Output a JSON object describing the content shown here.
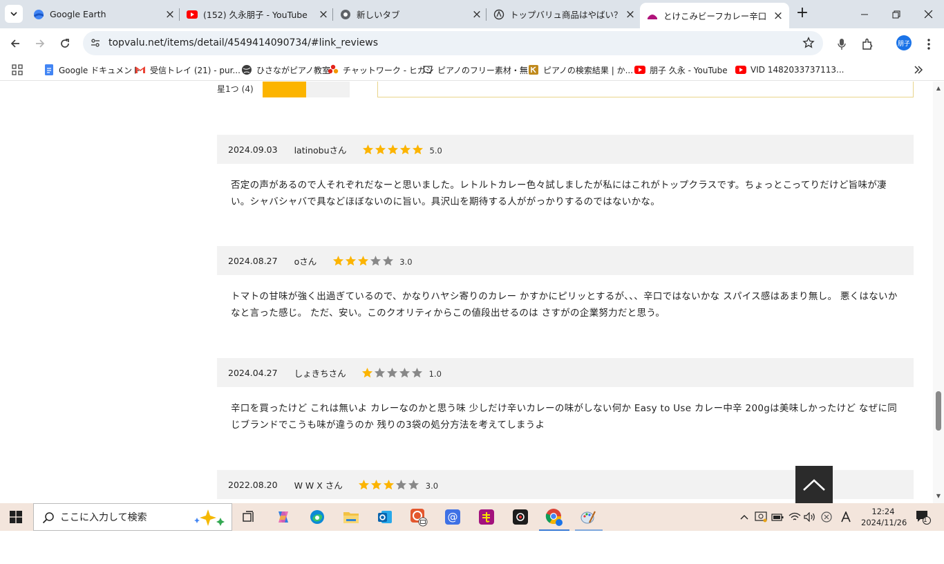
{
  "browser": {
    "tabs": [
      {
        "title": "Google Earth",
        "icon": "google-earth-icon",
        "active": false
      },
      {
        "title": "(152) 久永朋子 - YouTube",
        "icon": "youtube-icon",
        "active": false
      },
      {
        "title": "新しいタブ",
        "icon": "chrome-icon",
        "active": false
      },
      {
        "title": "トップバリュ商品はやばい？なぜ",
        "icon": "openai-icon",
        "active": false
      },
      {
        "title": "とけこみビーフカレー辛口 -イオン",
        "icon": "topvalu-icon",
        "active": true
      }
    ],
    "url": "topvalu.net/items/detail/4549414090734/#link_reviews",
    "profile_label": "朋子",
    "bookmarks": [
      {
        "label": "Google ドキュメント",
        "icon": "google-docs-icon"
      },
      {
        "label": "受信トレイ (21) - pur...",
        "icon": "gmail-icon"
      },
      {
        "label": "ひさながピアノ教室",
        "icon": "globe-icon"
      },
      {
        "label": "チャットワーク - ヒガシ",
        "icon": "chatwork-icon"
      },
      {
        "label": "ピアノのフリー素材・無...",
        "icon": "bookmark-site-icon"
      },
      {
        "label": "ピアノの検索結果 | か...",
        "icon": "bookmark-site-icon"
      },
      {
        "label": "朋子 久永 - YouTube",
        "icon": "youtube-icon"
      },
      {
        "label": "VID 1482033737113...",
        "icon": "youtube-icon"
      }
    ]
  },
  "page": {
    "rating_summary": {
      "label": "星1つ",
      "count": "(4)",
      "fill_fraction": 0.5
    },
    "reviews": [
      {
        "date": "2024.09.03",
        "user": "latinobuさん",
        "rating": 5,
        "score": "5.0",
        "body": "否定の声があるので人それぞれだなーと思いました。レトルトカレー色々試しましたが私にはこれがトップクラスです。ちょっとこってりだけど旨味が凄い。シャバシャバで具などほぼないのに旨い。具沢山を期待する人ががっかりするのではないかな。"
      },
      {
        "date": "2024.08.27",
        "user": "oさん",
        "rating": 3,
        "score": "3.0",
        "body": "トマトの甘味が強く出過ぎているので、かなりハヤシ寄りのカレー かすかにピリッとするが、、、辛口ではないかな スパイス感はあまり無し。 悪くはないかなと言った感じ。 ただ、安い。このクオリティからこの値段出せるのは さすがの企業努力だと思う。"
      },
      {
        "date": "2024.04.27",
        "user": "しょきちさん",
        "rating": 1,
        "score": "1.0",
        "body": "辛口を買ったけど これは無いよ カレーなのかと思う味 少しだけ辛いカレーの味がしない何か Easy to Use カレー中辛 200gは美味しかったけど なぜに同じブランドでこうも味が違うのか 残りの3袋の処分方法を考えてしまうよ"
      },
      {
        "date": "2022.08.20",
        "user": "W W X さん",
        "rating": 3,
        "score": "3.0",
        "body": ""
      }
    ],
    "star_color": "#fcb400",
    "star_empty_color": "#888888"
  },
  "taskbar": {
    "search_placeholder": "ここに入力して検索",
    "time": "12:24",
    "date": "2024/11/26",
    "notification_count": "1"
  }
}
